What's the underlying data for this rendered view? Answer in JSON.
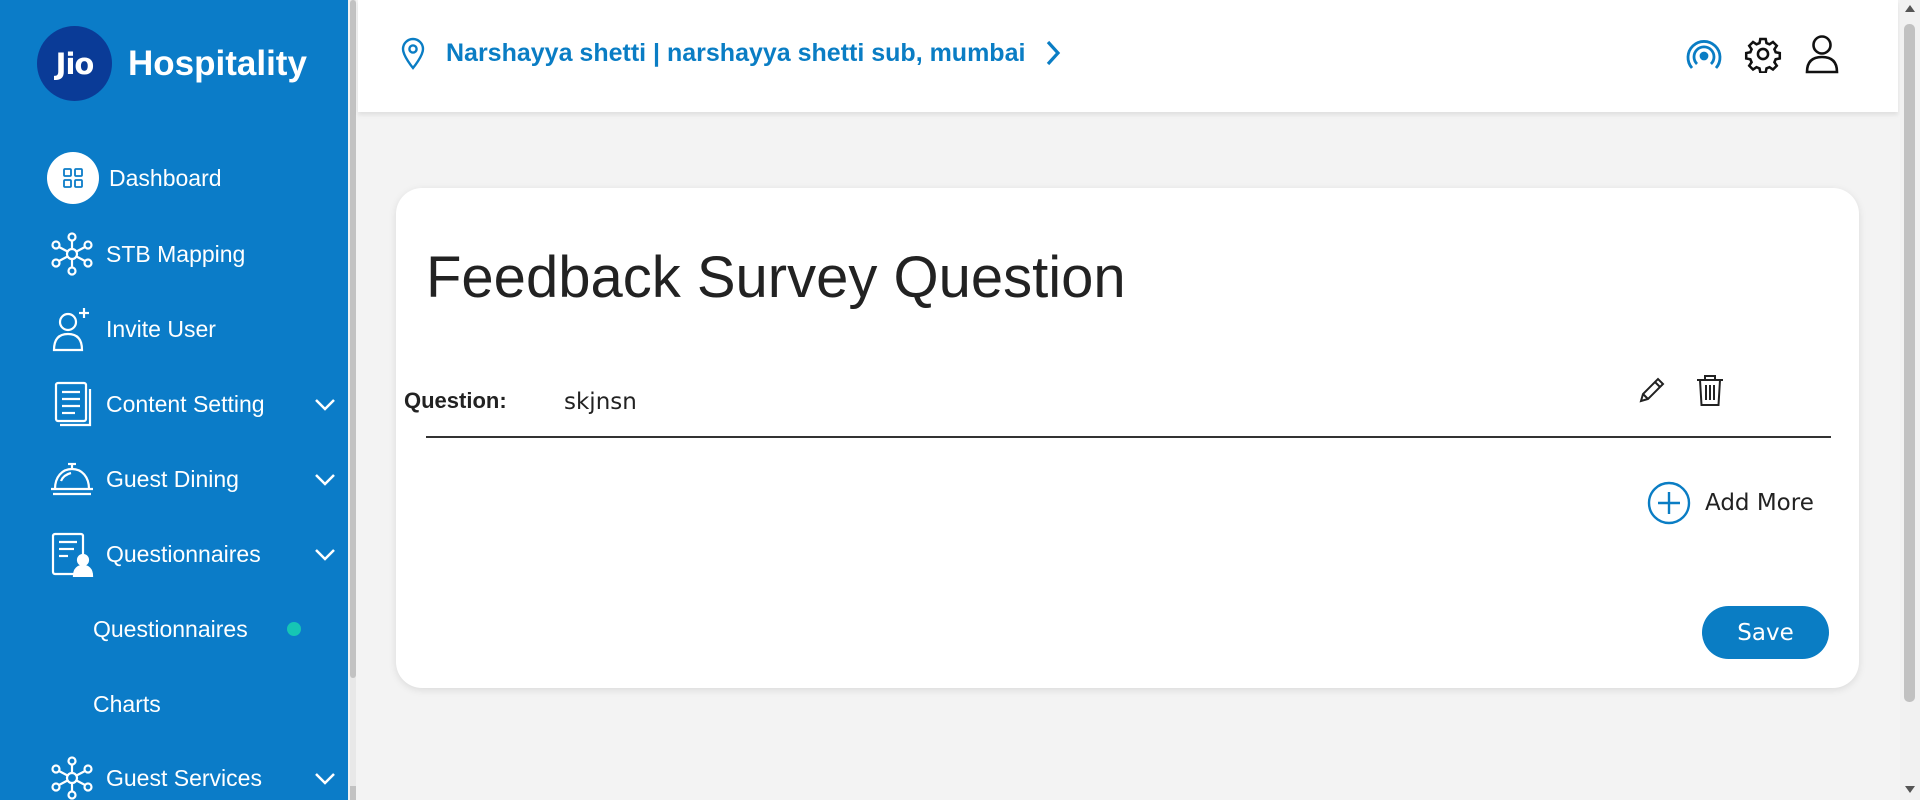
{
  "brand": {
    "logo_text": "Jio",
    "name": "Hospitality"
  },
  "sidebar": {
    "items": [
      {
        "label": "Dashboard",
        "icon": "dashboard-grid-icon"
      },
      {
        "label": "STB Mapping",
        "icon": "network-hub-icon"
      },
      {
        "label": "Invite User",
        "icon": "add-user-icon"
      },
      {
        "label": "Content Setting",
        "icon": "document-icon",
        "expandable": true
      },
      {
        "label": "Guest Dining",
        "icon": "cloche-icon",
        "expandable": true
      },
      {
        "label": "Questionnaires",
        "icon": "form-user-icon",
        "expandable": true
      },
      {
        "label": "Guest Services",
        "icon": "network-hub-icon",
        "expandable": true
      }
    ],
    "subitems": [
      {
        "label": "Questionnaires",
        "active": true
      },
      {
        "label": "Charts",
        "active": false
      }
    ]
  },
  "header": {
    "location": "Narshayya shetti | narshayya shetti sub, mumbai",
    "icons": [
      "broadcast-icon",
      "gear-icon",
      "user-icon"
    ]
  },
  "card": {
    "title": "Feedback Survey Question",
    "question_label": "Question:",
    "question_value": "skjnsn",
    "add_more_label": "Add More",
    "save_label": "Save"
  },
  "colors": {
    "sidebar_bg": "#0b7cc8",
    "logo_bg": "#0a3b97",
    "accent": "#0a7dc4",
    "active_dot": "#16c5b4",
    "page_bg": "#f3f3f3"
  }
}
